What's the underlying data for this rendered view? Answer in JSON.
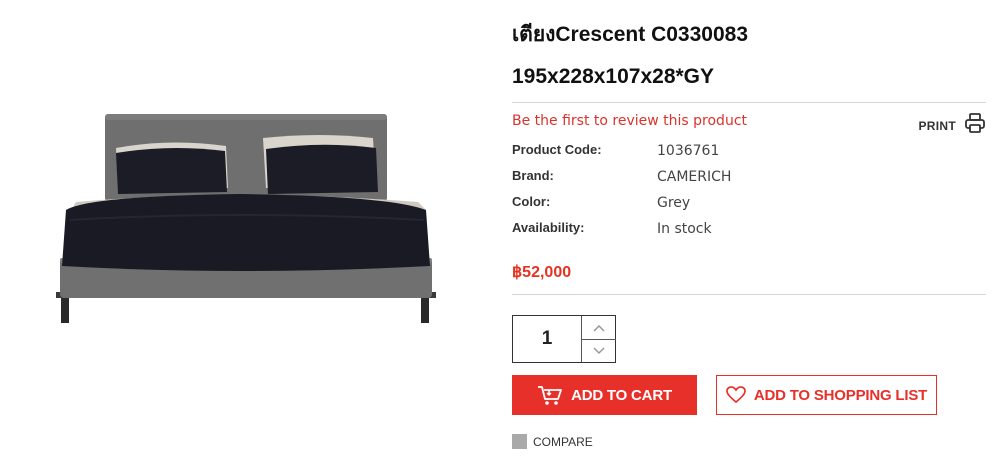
{
  "product": {
    "title_line1": "เตียงCrescent C0330083",
    "title_line2": "195x228x107x28*GY",
    "image_icon": "bed-photo",
    "review_link": "Be the first to review this product",
    "print_label": "PRINT",
    "print_icon": "printer-icon",
    "specs": [
      {
        "label": "Product Code:",
        "value": "1036761"
      },
      {
        "label": "Brand:",
        "value": "CAMERICH"
      },
      {
        "label": "Color:",
        "value": "Grey"
      },
      {
        "label": "Availability:",
        "value": "In stock"
      }
    ],
    "price": "฿52,000"
  },
  "purchase": {
    "quantity": "1",
    "add_to_cart_label": "ADD TO CART",
    "add_to_cart_icon": "cart-icon",
    "add_to_list_label": "ADD TO SHOPPING LIST",
    "add_to_list_icon": "heart-icon",
    "compare_label": "COMPARE"
  },
  "colors": {
    "accent": "#e8302a",
    "price": "#e53322",
    "review_link": "#d9332b"
  }
}
